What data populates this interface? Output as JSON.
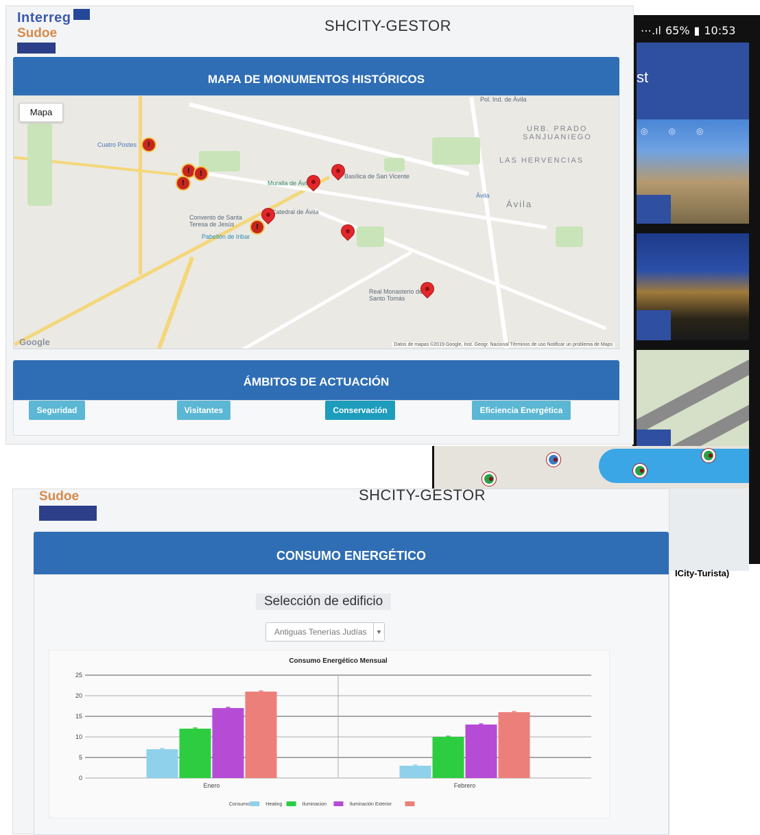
{
  "phone": {
    "status_signal": "⋯.ıl",
    "status_battery_pct": "65%",
    "status_time": "10:53",
    "header_fragment": "st",
    "caption_fragment": "ICity-Turista)"
  },
  "gestor_top": {
    "logo_interreg": "Interreg",
    "logo_sudoe": "Sudoe",
    "app_title": "SHCITY-GESTOR",
    "map_section_title": "MAPA DE MONUMENTOS HISTÓRICOS",
    "map_type_button": "Mapa",
    "map_google": "Google",
    "map_attribution": "Datos de mapas ©2019 Google, Inst. Geogr. Nacional   Términos de uso   Notificar un problema de Maps",
    "map_labels": {
      "cuatro_postes": "Cuatro Postes",
      "urb_prado": "URB. PRADO",
      "sanjuaniego": "SANJUANIEGO",
      "las_hervencias": "LAS HERVENCIAS",
      "avila": "Ávila",
      "basilica": "Basílica de San Vicente",
      "muralla": "Muralla de Ávila",
      "catedral": "Catedral de Ávila",
      "convento": "Convento de Santa Teresa de Jesús",
      "pabellon": "Pabellón de Iribar",
      "real_monasterio": "Real Monasterio de Santo Tomás",
      "pol_ind": "Pol. Ind. de Ávila",
      "avila_station": "Ávila"
    },
    "ambitos_title": "ÁMBITOS DE ACTUACIÓN",
    "ambitos_buttons": [
      "Seguridad",
      "Visitantes",
      "Conservación",
      "Eficiencia Energética"
    ]
  },
  "gestor_bottom": {
    "logo_sudoe": "Sudoe",
    "app_title": "SHCITY-GESTOR",
    "section_title": "CONSUMO ENERGÉTICO",
    "building_label": "Selección de edificio",
    "building_selected": "Antiguas Tenerías Judías"
  },
  "colors": {
    "header_blue": "#2f6eb5",
    "button_cyan": "#5bb7d3",
    "series": [
      "#8fd1ea",
      "#2ecc40",
      "#b64bd6",
      "#ec7f7a"
    ]
  },
  "chart_data": {
    "type": "bar",
    "title": "Consumo Energético Mensual",
    "categories": [
      "Enero",
      "Febrero"
    ],
    "series": [
      {
        "name": "Consumo",
        "values": [
          7,
          3
        ]
      },
      {
        "name": "Heating",
        "values": [
          12,
          10
        ]
      },
      {
        "name": "Iluminacion",
        "values": [
          17,
          13
        ]
      },
      {
        "name": "Iluminación Exterior",
        "values": [
          21,
          16
        ]
      }
    ],
    "yticks": [
      "25",
      "20",
      "15",
      "10",
      "5",
      "0"
    ],
    "ylim": [
      0,
      25
    ],
    "grid": true,
    "legend_position": "bottom"
  }
}
